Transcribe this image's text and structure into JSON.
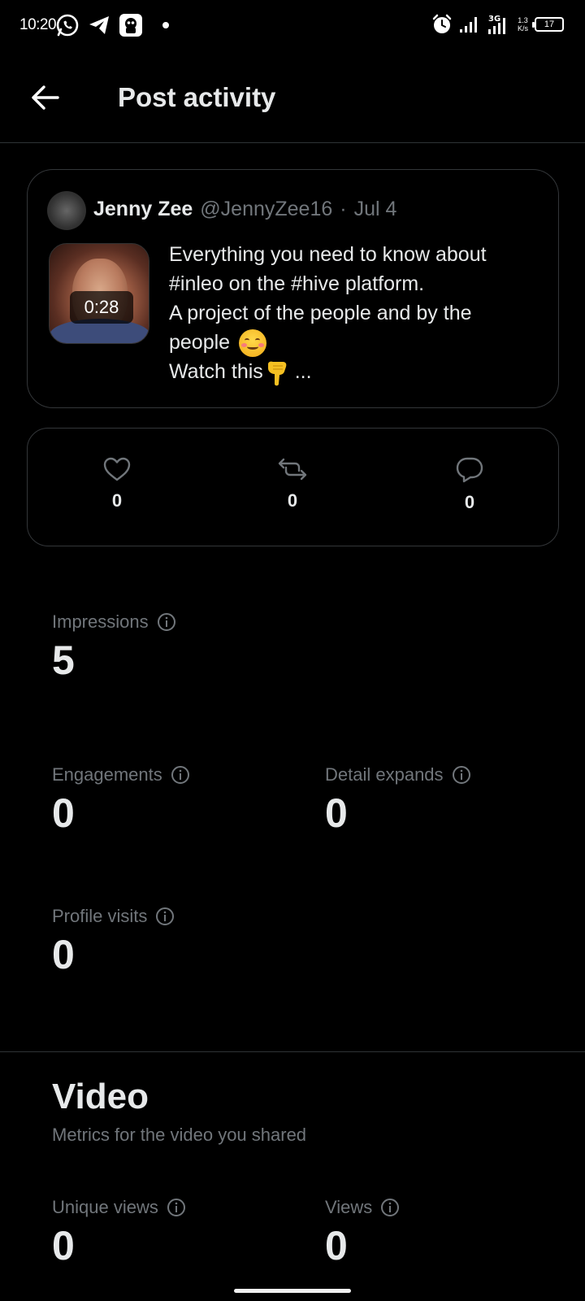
{
  "status_bar": {
    "time": "10:20",
    "speed": [
      "1.3",
      "K/s"
    ],
    "battery": "17",
    "network": "3G"
  },
  "header": {
    "title": "Post activity"
  },
  "post": {
    "author_name": "Jenny Zee",
    "author_handle": "@JennyZee16",
    "separator": "·",
    "date": "Jul 4",
    "video_duration": "0:28",
    "text_lines": [
      "Everything you need to know about",
      "#inleo on the #hive platform.",
      "A project of the people and by the",
      "people",
      "Watch this",
      "..."
    ]
  },
  "engagement": {
    "likes": "0",
    "reposts": "0",
    "replies": "0"
  },
  "metrics": {
    "impressions_label": "Impressions",
    "impressions_value": "5",
    "engagements_label": "Engagements",
    "engagements_value": "0",
    "detail_expands_label": "Detail expands",
    "detail_expands_value": "0",
    "profile_visits_label": "Profile visits",
    "profile_visits_value": "0"
  },
  "video_section": {
    "title": "Video",
    "subtitle": "Metrics for the video you shared",
    "unique_views_label": "Unique views",
    "unique_views_value": "0",
    "views_label": "Views",
    "views_value": "0"
  },
  "colors": {
    "background": "#000000",
    "text_primary": "#e7e9ea",
    "text_secondary": "#71767b",
    "border": "#333639"
  }
}
